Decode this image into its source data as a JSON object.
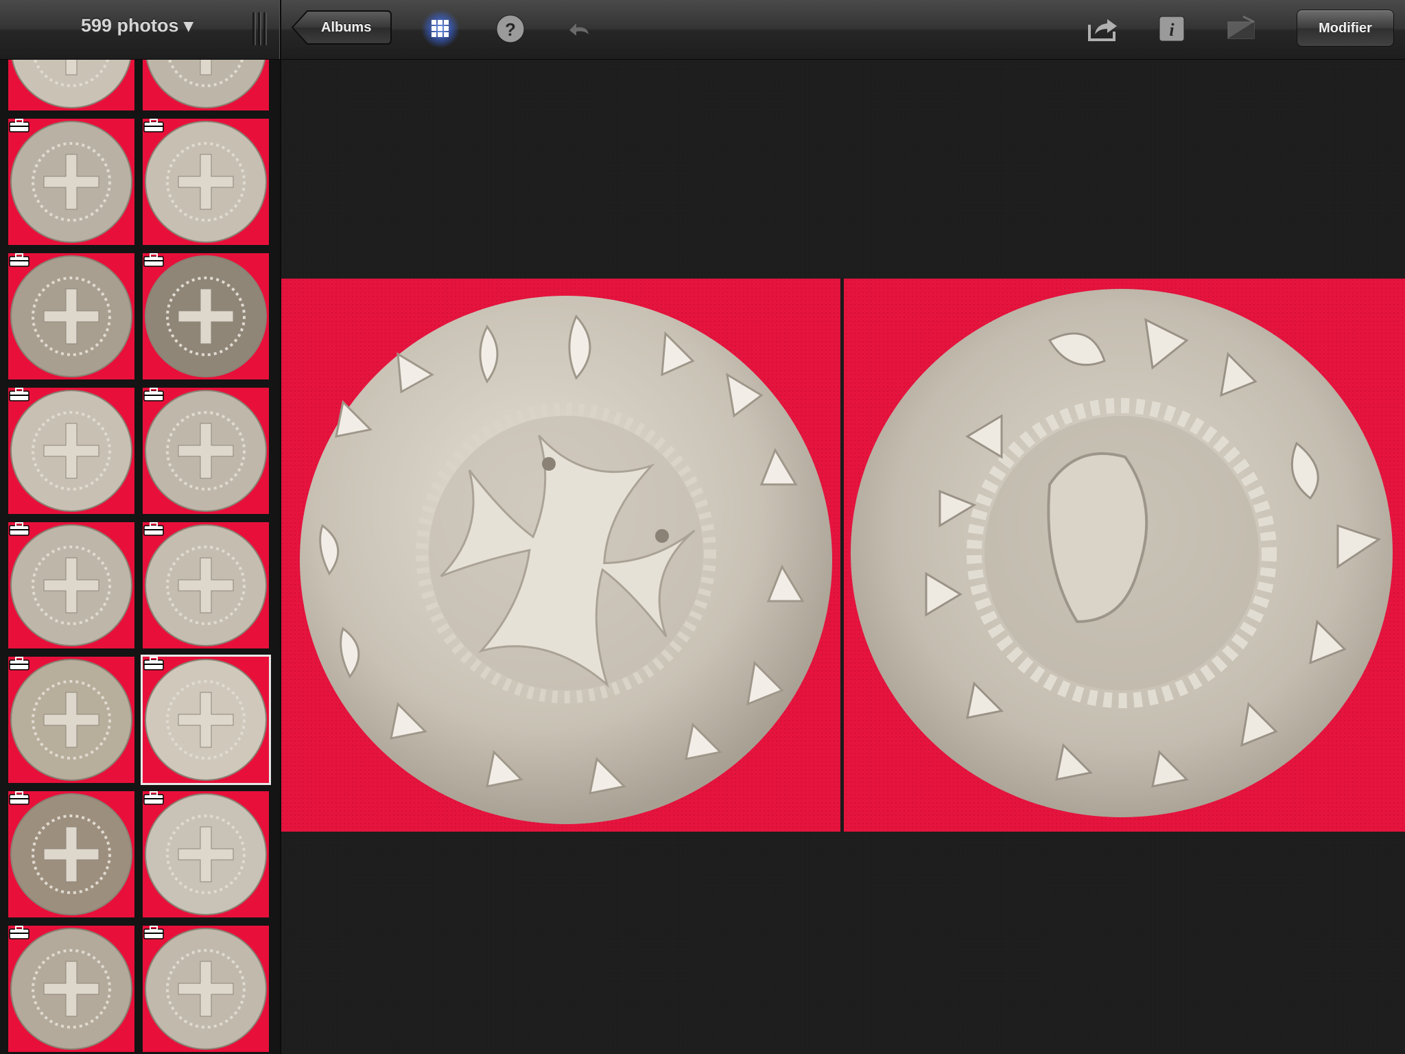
{
  "toolbar": {
    "photo_count": "599 photos ▾",
    "back_label": "Albums",
    "grid_icon": "grid-icon",
    "help_icon": "help-icon",
    "undo_icon": "undo-icon",
    "share_icon": "share-icon",
    "info_icon": "info-icon",
    "adjust_icon": "adjust-icon",
    "edit_label": "Modifier"
  },
  "colors": {
    "toolbar_bg": "#2c2c2c",
    "photo_bg": "#e5143e",
    "coin_silver": "#c9c2b5",
    "grid_accent": "#5f8bff"
  },
  "thumbnails": {
    "rows": 8,
    "columns": 2,
    "count": 16,
    "selected_index": 11,
    "badge_icon": "briefcase-icon"
  }
}
